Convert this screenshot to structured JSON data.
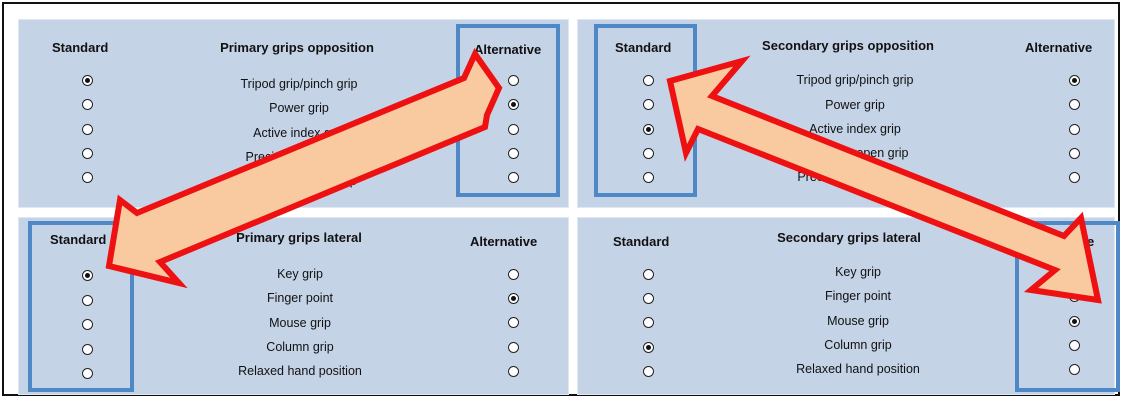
{
  "columns": {
    "standard": "Standard",
    "alternative": "Alternative"
  },
  "panels": {
    "primary_opposition": {
      "title": "Primary grips opposition",
      "options": [
        "Tripod grip/pinch grip",
        "Power grip",
        "Active index grip",
        "Precision open grip",
        "Precision closed grip"
      ],
      "standard_selected": 0,
      "alternative_selected": 1
    },
    "secondary_opposition": {
      "title": "Secondary grips opposition",
      "options": [
        "Tripod grip/pinch grip",
        "Power grip",
        "Active index grip",
        "Precision open grip",
        "Precision closed grip"
      ],
      "standard_selected": 2,
      "alternative_selected": 0
    },
    "primary_lateral": {
      "title": "Primary grips lateral",
      "options": [
        "Key grip",
        "Finger point",
        "Mouse grip",
        "Column grip",
        "Relaxed hand position"
      ],
      "standard_selected": 0,
      "alternative_selected": 1
    },
    "secondary_lateral": {
      "title": "Secondary grips lateral",
      "options": [
        "Key grip",
        "Finger point",
        "Mouse grip",
        "Column grip",
        "Relaxed hand position"
      ],
      "standard_selected": 3,
      "alternative_selected": 2
    }
  },
  "colors": {
    "panel": "#c5d3e7",
    "highlight_box": "#4f88c7",
    "arrow_fill": "#f9c9a0",
    "arrow_stroke": "#ee1111"
  },
  "annotations": [
    "arrow-standard-to-alternative-left",
    "arrow-alternative-to-standard-right"
  ]
}
